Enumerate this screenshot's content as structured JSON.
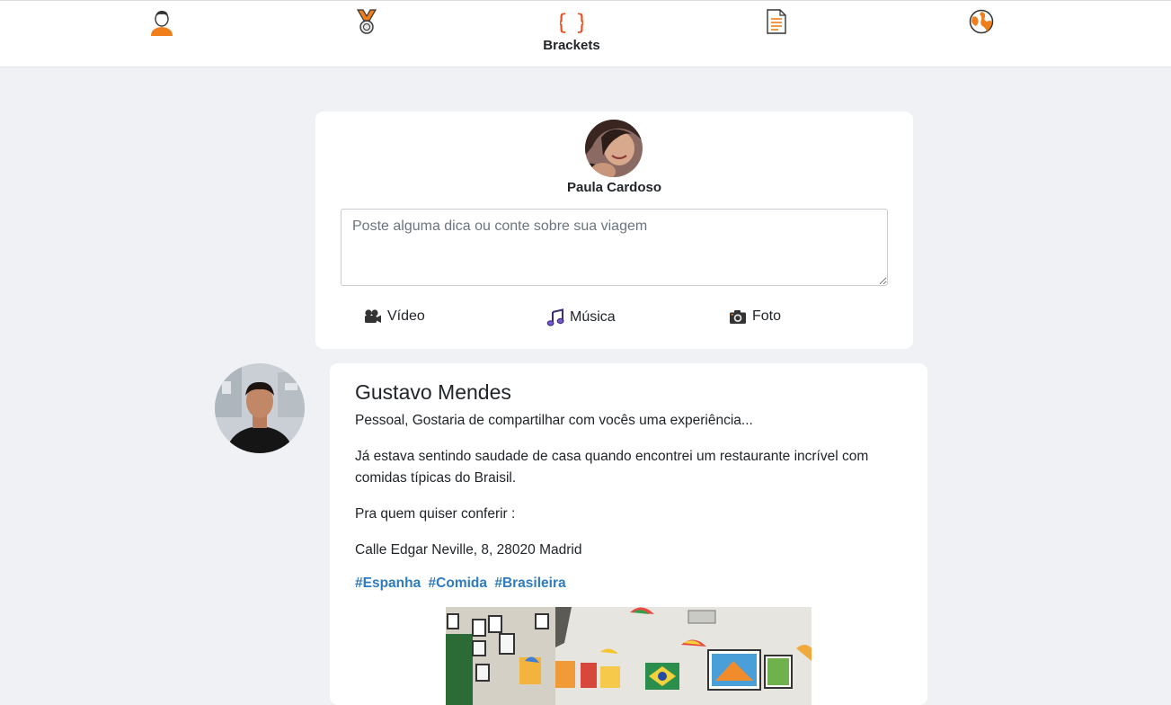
{
  "nav": {
    "items": [
      {
        "icon": "user-icon",
        "label": ""
      },
      {
        "icon": "medal-icon",
        "label": ""
      },
      {
        "icon": "brackets-icon",
        "label": "Brackets"
      },
      {
        "icon": "document-icon",
        "label": ""
      },
      {
        "icon": "globe-icon",
        "label": ""
      }
    ],
    "active_color": "#e8501f",
    "accent_color": "#f07f1b"
  },
  "composer": {
    "user_name": "Paula Cardoso",
    "placeholder": "Poste alguma dica ou conte sobre sua viagem",
    "value": "",
    "buttons": [
      {
        "icon": "video-camera-icon",
        "label": "Vídeo"
      },
      {
        "icon": "music-note-icon",
        "label": "Música"
      },
      {
        "icon": "photo-camera-icon",
        "label": "Foto"
      }
    ]
  },
  "post": {
    "author": "Gustavo Mendes",
    "paragraphs": [
      "Pessoal, Gostaria de compartilhar com vocês uma experiência...",
      "Já estava sentindo saudade de casa quando encontrei um restaurante incrível com comidas típicas do Braisil.",
      "Pra quem quiser conferir :",
      "Calle Edgar Neville, 8, 28020 Madrid"
    ],
    "hashtags": [
      "#Espanha",
      "#Comida",
      "#Brasileira"
    ],
    "hashtag_color": "#2f7bbf"
  }
}
